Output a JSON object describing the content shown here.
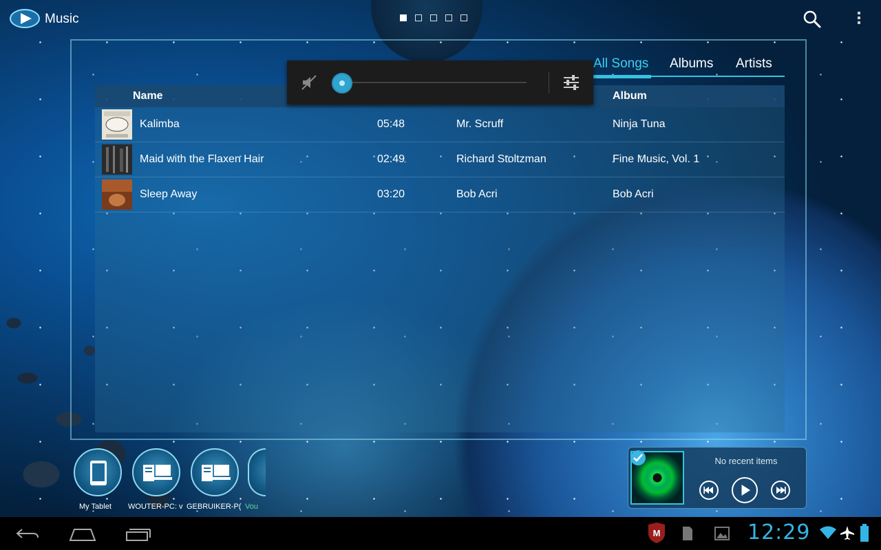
{
  "app": {
    "title": "Music"
  },
  "pager": {
    "pages": 5,
    "active": 0
  },
  "tabs": [
    {
      "label": "All Songs",
      "active": true
    },
    {
      "label": "Albums",
      "active": false
    },
    {
      "label": "Artists",
      "active": false
    }
  ],
  "table": {
    "headers": {
      "name": "Name",
      "album": "Album"
    },
    "rows": [
      {
        "name": "Kalimba",
        "duration": "05:48",
        "artist": "Mr. Scruff",
        "album": "Ninja Tuna"
      },
      {
        "name": "Maid with the Flaxen Hair",
        "duration": "02:49",
        "artist": "Richard Stoltzman",
        "album": "Fine Music, Vol. 1"
      },
      {
        "name": "Sleep Away",
        "duration": "03:20",
        "artist": "Bob Acri",
        "album": "Bob Acri"
      }
    ]
  },
  "volume": {
    "level": 0,
    "muted": true
  },
  "devices": [
    {
      "label": "My Tablet",
      "icon": "tablet-icon"
    },
    {
      "label": "WOUTER-PC: v",
      "icon": "server-icon"
    },
    {
      "label": "GEBRUIKER-P(",
      "icon": "server-icon"
    },
    {
      "label": "Vou",
      "icon": "server-icon"
    }
  ],
  "now_playing": {
    "text": "No recent items"
  },
  "system": {
    "clock": "12:29"
  },
  "colors": {
    "accent": "#36c3e0",
    "clock": "#34b5e5"
  }
}
